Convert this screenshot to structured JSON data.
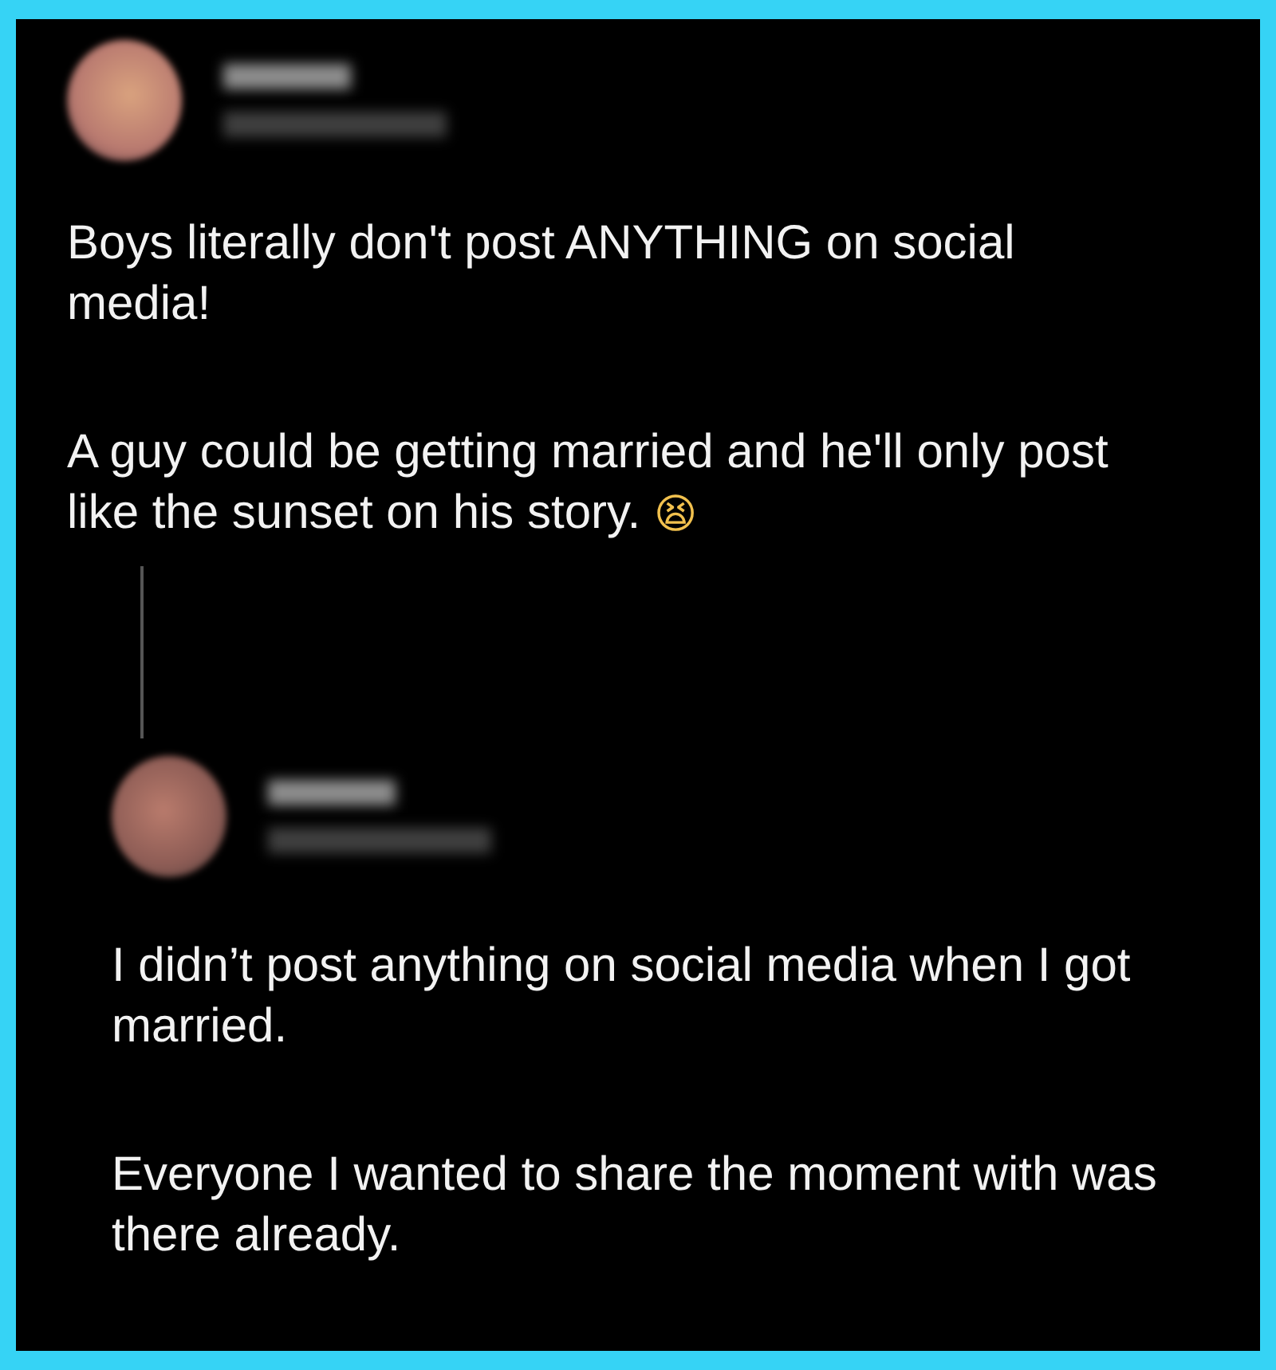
{
  "posts": [
    {
      "paragraphs": [
        "Boys literally don't post ANYTHING on social media!",
        "A guy could be getting married and he'll only post like the sunset on his story."
      ],
      "emoji": "😫"
    },
    {
      "paragraphs": [
        "I didn’t post anything on social media when I got married.",
        "Everyone I wanted to share the moment with was there already."
      ]
    }
  ]
}
